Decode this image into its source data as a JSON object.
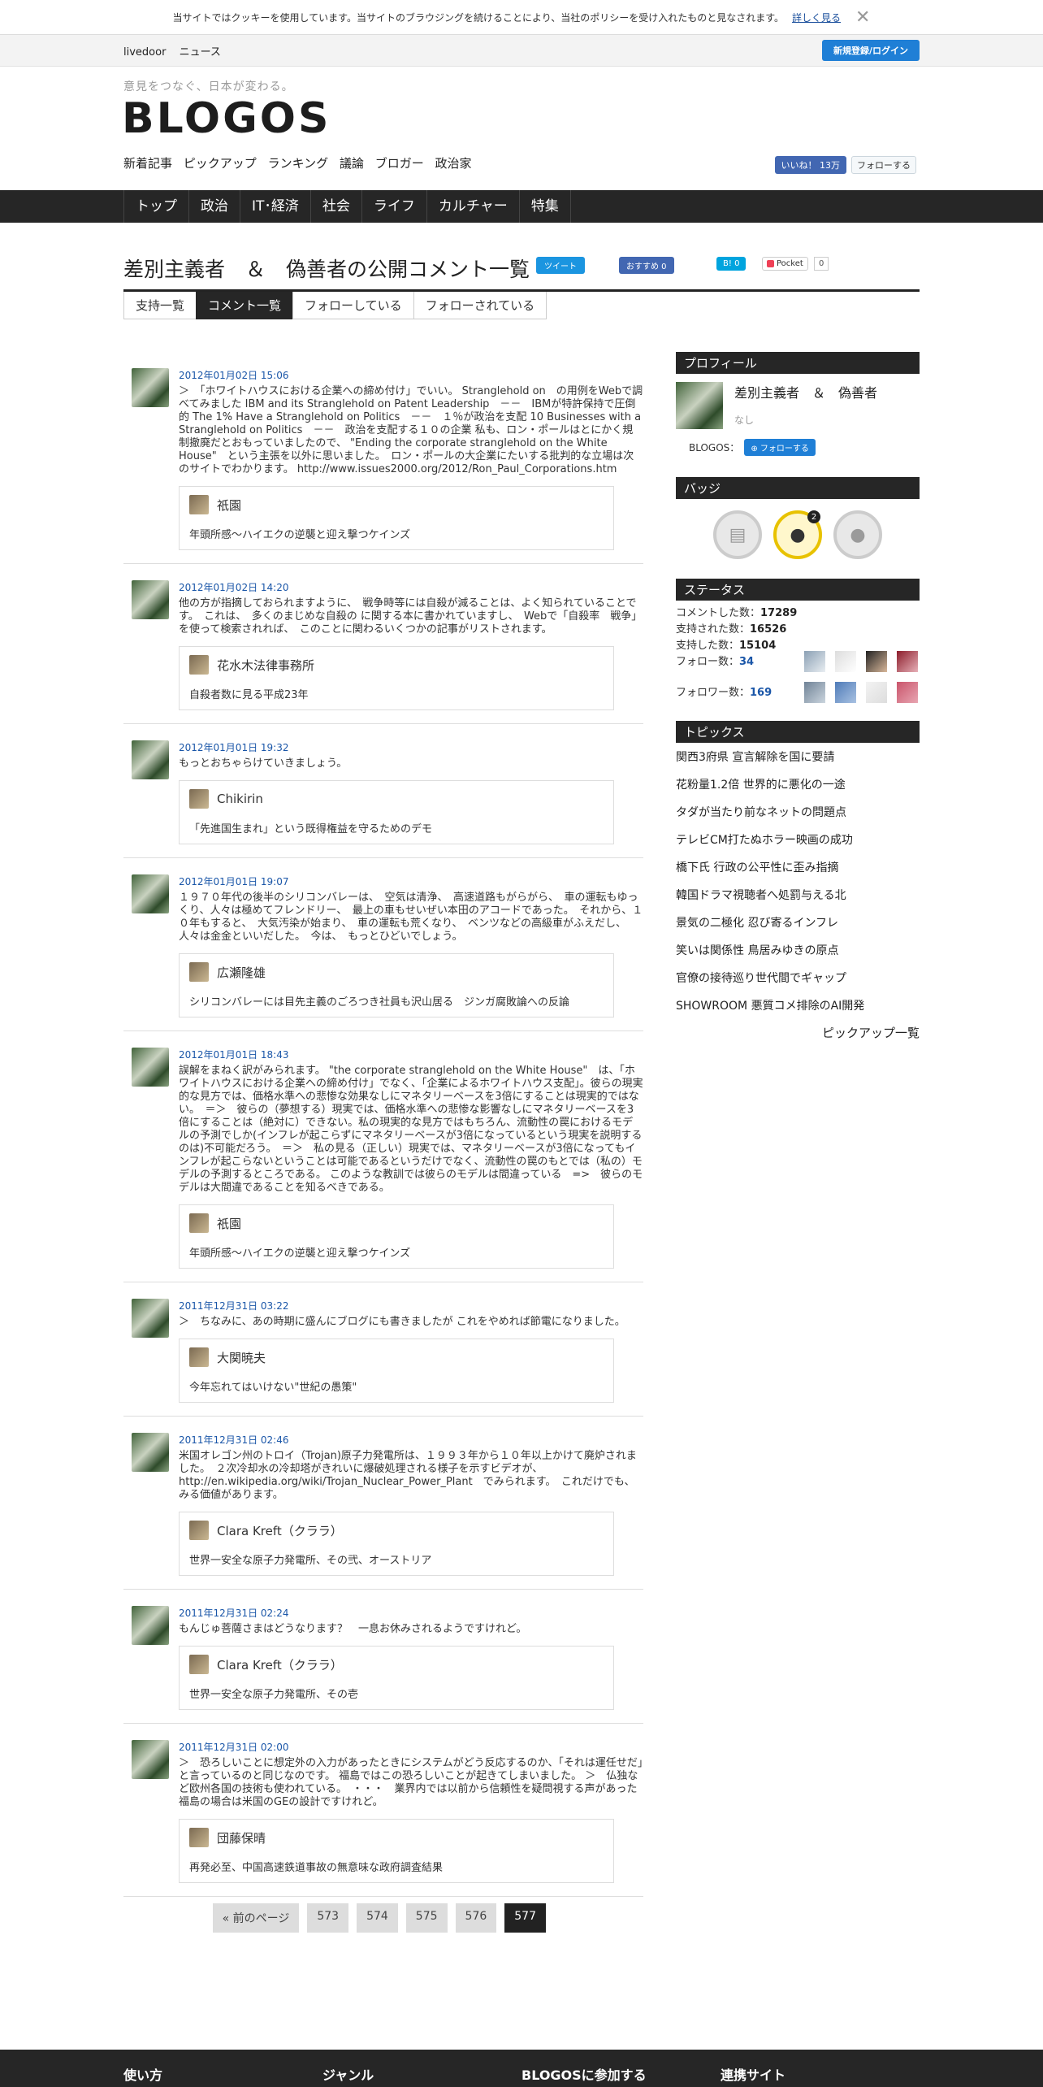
{
  "cookie": {
    "text": "当サイトではクッキーを使用しています。当サイトのブラウジングを続けることにより、当社のポリシーを受け入れたものと見なされます。",
    "more": "詳しく見る"
  },
  "topbar": {
    "links": [
      "livedoor",
      "ニュース"
    ],
    "login": "新規登録/ログイン"
  },
  "header": {
    "tagline": "意見をつなぐ、日本が変わる。",
    "logo": "BLOGOS",
    "subnav": [
      "新着記事",
      "ピックアップ",
      "ランキング",
      "議論",
      "ブロガー",
      "政治家"
    ],
    "fb_like": "いいね！ 13万",
    "tw_follow": "フォローする"
  },
  "mainnav": [
    "トップ",
    "政治",
    "IT･経済",
    "社会",
    "ライフ",
    "カルチャー",
    "特集"
  ],
  "page": {
    "title": "差別主義者　＆　偽善者の公開コメント一覧",
    "share": {
      "tweet": "ツイート",
      "fb": "おすすめ 0",
      "hatena": "0",
      "pocket": "Pocket",
      "pocket_count": "0"
    },
    "tabs": [
      "支持一覧",
      "コメント一覧",
      "フォローしている",
      "フォローされている"
    ]
  },
  "comments": [
    {
      "ts": "2012年01月02日 15:06",
      "text": "＞　「ホワイトハウスにおける企業への締め付け」でいい。 Stranglehold on　の用例をWebで調べてみました IBM and its Stranglehold on Patent Leadership　－－　IBMが特許保持で圧倒的 The 1% Have a Stranglehold on Politics　－－　１％が政治を支配 10 Businesses with a Stranglehold on Politics　－－　政治を支配する１０の企業 私も、ロン・ポールはとにかく規制撤廃だとおもっていましたので、 \"Ending the corporate stranglehold on the White House\"　という主張を以外に思いました。　ロン・ポールの大企業にたいする批判的な立場は次のサイトでわかります。 http://www.issues2000.org/2012/Ron_Paul_Corporations.htm",
      "user": "祇園",
      "post": "年頭所感〜ハイエクの逆襲と迎え撃つケインズ"
    },
    {
      "ts": "2012年01月02日 14:20",
      "text": "他の方が指摘しておられますように、　戦争時等には自殺が減ることは、よく知られていることです。　これは、　多くのまじめな自殺の に関する本に書かれていますし、　Webで「自殺率　戦争」を使って検索されれば、　このことに関わるいくつかの記事がリストされます。",
      "user": "花水木法律事務所",
      "post": "自殺者数に見る平成23年"
    },
    {
      "ts": "2012年01月01日 19:32",
      "text": "もっとおちゃらけていきましょう。",
      "user": "Chikirin",
      "post": "「先進国生まれ」という既得権益を守るためのデモ"
    },
    {
      "ts": "2012年01月01日 19:07",
      "text": "１９７０年代の後半のシリコンバレーは、　空気は清浄、　高速道路もがらがら、　車の運転もゆっくり、人々は極めてフレンドリー、　最上の車もせいぜい本田のアコードであった。　それから、１０年もすると、　大気汚染が始まり、　車の運転も荒くなり、　ベンツなどの高級車がふえだし、人々は金金といいだした。　今は、　もっとひどいでしょう。",
      "user": "広瀬隆雄",
      "post": "シリコンバレーには目先主義のごろつき社員も沢山居る　ジンガ腐敗論への反論"
    },
    {
      "ts": "2012年01月01日 18:43",
      "text": "誤解をまねく訳がみられます。 \"the corporate stranglehold on the White House\"　は、「ホワイトハウスにおける企業への締め付け」でなく、「企業によるホワイトハウス支配」。彼らの現実的な見方では、価格水準への悲惨な効果なしにマネタリーベースを3倍にすることは現実的ではない。　＝＞　彼らの（夢想する）現実では、価格水準への悲惨な影響なしにマネタリーベースを3倍にすることは（絶対に）できない。私の現実的な見方ではもちろん、流動性の罠におけるモデルの予測でしか(インフレが起こらずにマネタリーベースが3倍になっているという現実を説明するのは)不可能だろう。　＝＞　私の見る（正しい）現実では、マネタリーベースが3倍になってもインフレが起こらないということは可能であるというだけでなく、流動性の罠のもとでは（私の）モデルの予測するところである。 このような教訓では彼らのモデルは間違っている　=>　彼らのモデルは大間違であることを知るべきである。",
      "user": "祇園",
      "post": "年頭所感〜ハイエクの逆襲と迎え撃つケインズ"
    },
    {
      "ts": "2011年12月31日 03:22",
      "text": "＞　ちなみに、あの時期に盛んにブログにも書きましたが これをやめれば節電になりました。",
      "user": "大関暁夫",
      "post": "今年忘れてはいけない\"世紀の愚策\""
    },
    {
      "ts": "2011年12月31日 02:46",
      "text": "米国オレゴン州のトロイ（Trojan)原子力発電所は、１９９３年から１０年以上かけて廃炉されました。　２次冷却水の冷却塔がきれいに爆破処理される様子を示すビデオが、 http://en.wikipedia.org/wiki/Trojan_Nuclear_Power_Plant　でみられます。　これだけでも、みる価値があります。",
      "user": "Clara Kreft（クララ）",
      "post": "世界一安全な原子力発電所、その弐、オーストリア"
    },
    {
      "ts": "2011年12月31日 02:24",
      "text": "もんじゅ菩薩さまはどうなります？　一息お休みされるようですけれど。",
      "user": "Clara Kreft（クララ）",
      "post": "世界一安全な原子力発電所、その壱"
    },
    {
      "ts": "2011年12月31日 02:00",
      "text": "＞　恐ろしいことに想定外の入力があったときにシステムがどう反応するのか、「それは運任せだ」と言っているのと同じなのです。 福島ではこの恐ろしいことが起きてしまいました。 ＞　仏独など欧州各国の技術も使われている。　・・・　業界内では以前から信頼性を疑問視する声があった 福島の場合は米国のGEの設計ですけれど。",
      "user": "団藤保晴",
      "post": "再発必至、中国高速鉄道事故の無意味な政府調査結果"
    }
  ],
  "pager": {
    "prev": "« 前のページ",
    "pages": [
      "573",
      "574",
      "575",
      "576",
      "577"
    ]
  },
  "sidebar": {
    "profile_head": "プロフィール",
    "name": "差別主義者　＆　偽善者",
    "none": "なし",
    "blogos_label": "BLOGOS：",
    "follow": "フォローする",
    "badge_head": "バッジ",
    "badge_count": "2",
    "status_head": "ステータス",
    "stats": [
      {
        "label": "コメントした数：",
        "value": "17289"
      },
      {
        "label": "支持された数：",
        "value": "16526"
      },
      {
        "label": "支持した数：",
        "value": "15104"
      },
      {
        "label": "フォロー数：",
        "value": "34"
      },
      {
        "label": "フォロワー数：",
        "value": "169"
      }
    ],
    "topics_head": "トピックス",
    "topics": [
      "関西3府県 宣言解除を国に要請",
      "花粉量1.2倍 世界的に悪化の一途",
      "タダが当たり前なネットの問題点",
      "テレビCM打たぬホラー映画の成功",
      "橋下氏 行政の公平性に歪み指摘",
      "韓国ドラマ視聴者へ処罰与える北",
      "景気の二極化 忍び寄るインフレ",
      "笑いは関係性 鳥居みゆきの原点",
      "官僚の接待巡り世代間でギャップ",
      "SHOWROOM 悪質コメ排除のAI開発"
    ],
    "pickup": "ピックアップ一覧"
  },
  "footer": [
    "使い方",
    "ジャンル",
    "BLOGOSに参加する",
    "連携サイト"
  ]
}
